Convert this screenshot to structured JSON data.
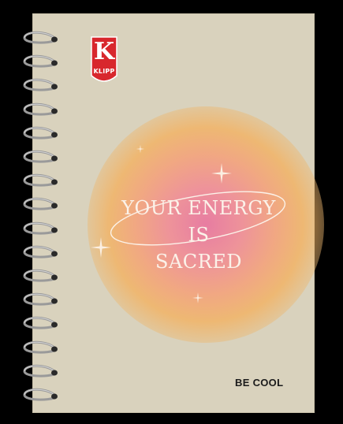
{
  "brand": {
    "name": "KLIPP",
    "letter": "K",
    "color": "#d8272d"
  },
  "cover": {
    "quote_line1": "YOUR ENERGY IS",
    "quote_line2": "SACRED",
    "tagline": "BE COOL",
    "background_color": "#d9d2bd"
  },
  "icons": [
    "spiral-ring-icon",
    "sparkle-icon"
  ]
}
